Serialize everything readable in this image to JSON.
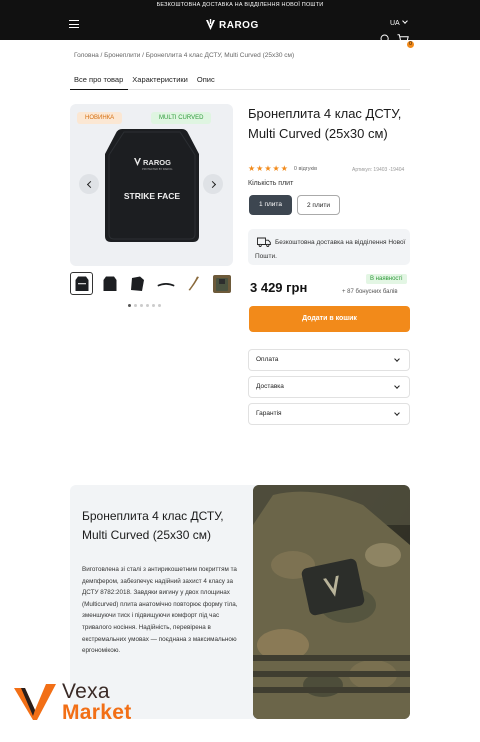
{
  "topbar": {
    "text": "БЕЗКОШТОВНА ДОСТАВКА НА ВІДДІЛЕННЯ НОВОЇ ПОШТИ"
  },
  "header": {
    "logo_text": "RAROG",
    "lang": "UA",
    "cart_count": "0"
  },
  "breadcrumb": "Головна / Бронеплити / Бронеплита 4 клас ДСТУ, Multi Curved (25x30 см)",
  "tabs": [
    {
      "label": "Все про товар",
      "active": true
    },
    {
      "label": "Характеристики",
      "active": false
    },
    {
      "label": "Опис",
      "active": false
    }
  ],
  "gallery": {
    "tag_new": "НОВИНКА",
    "tag_curved": "MULTI CURVED",
    "plate_brand": "RAROG",
    "plate_motto": "PROTECTED BY RAROG",
    "plate_label": "STRIKE FACE",
    "thumb_count": 6,
    "active_slide": 1,
    "slide_count": 6
  },
  "product": {
    "title": "Бронеплита 4 клас ДСТУ, Multi Curved (25x30 см)",
    "rating": 5,
    "reviews": "0 відгуків",
    "sku": "Артикул: 19403 -19404",
    "quantity_label": "Кількість плит",
    "quantity_options": [
      "1 плита",
      "2 плити"
    ],
    "selected_quantity": "1 плита",
    "delivery_text": "Безкоштовна доставка на відділення Нової Пошти.",
    "price": "3 429 грн",
    "stock": "В наявності",
    "bonus": "+ 87 бонусних балів",
    "buy_label": "Додати в кошик"
  },
  "accordions": [
    "Оплата",
    "Доставка",
    "Гарантія"
  ],
  "promo": {
    "title": "Бронеплита 4 клас ДСТУ, Multi Curved (25x30 см)",
    "text": "Виготовлена зі сталі з антирикошетним покриттям та демпфером, забезпечує надійний захист 4 класу за ДСТУ 8782:2018. Завдяки вигину у двох площинах (Multicurved) плита анатомічно повторює форму тіла, зменшуючи тиск і підвищуючи комфорт під час тривалого носіння. Надійність, перевірена в екстремальних умовах — поєднана з максимальною ергономікою."
  },
  "watermark": {
    "line1": "Vexa",
    "line2": "Market"
  },
  "colors": {
    "accent": "#f28a1a",
    "dark": "#111111",
    "success": "#2e9a3a",
    "panel": "#f2f4f6"
  }
}
